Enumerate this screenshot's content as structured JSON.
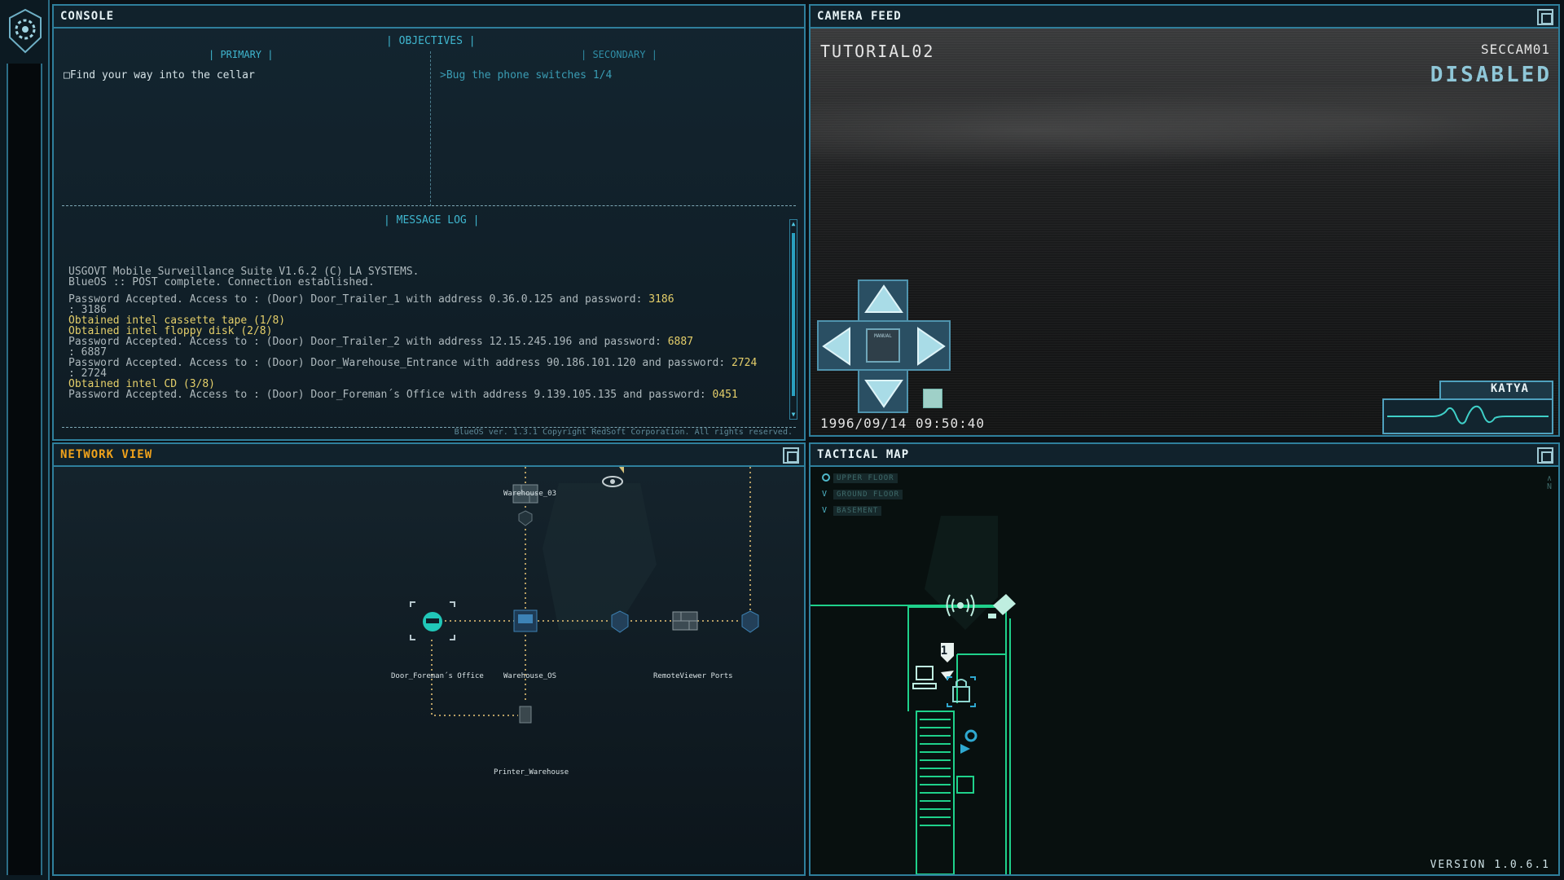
{
  "sidebar": {
    "logo_icon": "gear-shield-logo"
  },
  "console": {
    "title": "CONSOLE",
    "objectives_header": "| OBJECTIVES |",
    "primary_header": "| PRIMARY |",
    "secondary_header": "| SECONDARY |",
    "primary_items": [
      "□Find your way into the cellar"
    ],
    "secondary_items": [
      ">Bug the phone switches 1/4"
    ],
    "message_log_header": "| MESSAGE LOG |",
    "log": [
      {
        "text": "USGOVT Mobile Surveillance Suite V1.6.2 (C) LA SYSTEMS.",
        "type": "normal"
      },
      {
        "text": "BlueOS :: POST complete. Connection established.",
        "type": "normal"
      },
      {
        "text": "",
        "type": "gap"
      },
      {
        "text": "Password Accepted. Access to : (Door) Door_Trailer_1 with address 0.36.0.125 and password: ",
        "code": "3186",
        "type": "normal"
      },
      {
        "text": ": 3186",
        "type": "normal"
      },
      {
        "text": "Obtained intel cassette tape (1/8)",
        "type": "gold"
      },
      {
        "text": "Obtained intel floppy disk (2/8)",
        "type": "gold"
      },
      {
        "text": "Password Accepted. Access to : (Door) Door_Trailer_2 with address 12.15.245.196 and password: ",
        "code": "6887",
        "type": "normal"
      },
      {
        "text": ": 6887",
        "type": "normal"
      },
      {
        "text": "Password Accepted. Access to : (Door) Door_Warehouse_Entrance with address 90.186.101.120 and password: ",
        "code": "2724",
        "type": "normal"
      },
      {
        "text": ": 2724",
        "type": "normal"
      },
      {
        "text": "Obtained intel CD (3/8)",
        "type": "gold"
      },
      {
        "text": "Password Accepted. Access to : (Door) Door_Foreman´s Office with address 9.139.105.135 and password: ",
        "code": "0451",
        "type": "normal"
      }
    ],
    "footer": "BlueOS ver. 1.3.1 Copyright RedSoft Corporation. All rights reserved."
  },
  "camera": {
    "title": "CAMERA FEED",
    "name": "TUTORIAL02",
    "id": "SECCAM01",
    "status": "DISABLED",
    "timestamp": "1996/09/14 09:50:40",
    "manual_label": "MANUAL",
    "operator": "KATYA"
  },
  "network": {
    "title": "NETWORK VIEW",
    "nodes": [
      {
        "label": "Warehouse_03",
        "icon": "firewall-icon"
      },
      {
        "label": "Door_Foreman´s Office",
        "icon": "hacker-icon"
      },
      {
        "label": "Warehouse_OS",
        "icon": "computer-icon"
      },
      {
        "label": "RemoteViewer Ports",
        "icon": "firewall-icon"
      },
      {
        "label": "Printer_Warehouse",
        "icon": "printer-icon"
      }
    ]
  },
  "tactical": {
    "title": "TACTICAL MAP",
    "floors": [
      "UPPER FLOOR",
      "GROUND FLOOR",
      "BASEMENT"
    ],
    "marker_number": "1",
    "version": "VERSION 1.0.6.1"
  },
  "colors": {
    "frame": "#2f7f9c",
    "accent_cyan": "#3fb6cf",
    "network_title": "#f0a21b",
    "log_gold": "#e5cf6a",
    "map_green": "#1fd18b"
  }
}
